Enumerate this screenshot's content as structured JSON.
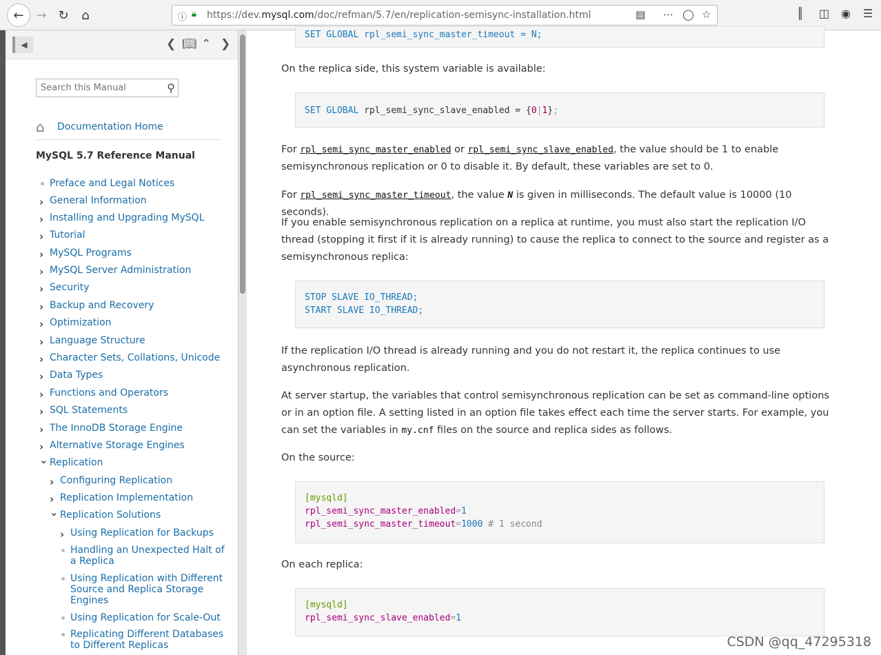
{
  "browser": {
    "url_prefix": "https://dev.",
    "url_domain": "mysql.com",
    "url_path": "/doc/refman/5.7/en/replication-semisync-installation.html"
  },
  "sidebar": {
    "search_placeholder": "Search this Manual",
    "doc_home": "Documentation Home",
    "manual_title": "MySQL 5.7 Reference Manual",
    "items": [
      {
        "label": "Preface and Legal Notices",
        "mark": "dot"
      },
      {
        "label": "General Information",
        "mark": "right"
      },
      {
        "label": "Installing and Upgrading MySQL",
        "mark": "right"
      },
      {
        "label": "Tutorial",
        "mark": "right"
      },
      {
        "label": "MySQL Programs",
        "mark": "right"
      },
      {
        "label": "MySQL Server Administration",
        "mark": "right"
      },
      {
        "label": "Security",
        "mark": "right"
      },
      {
        "label": "Backup and Recovery",
        "mark": "right"
      },
      {
        "label": "Optimization",
        "mark": "right"
      },
      {
        "label": "Language Structure",
        "mark": "right"
      },
      {
        "label": "Character Sets, Collations, Unicode",
        "mark": "right"
      },
      {
        "label": "Data Types",
        "mark": "right"
      },
      {
        "label": "Functions and Operators",
        "mark": "right"
      },
      {
        "label": "SQL Statements",
        "mark": "right"
      },
      {
        "label": "The InnoDB Storage Engine",
        "mark": "right"
      },
      {
        "label": "Alternative Storage Engines",
        "mark": "right"
      },
      {
        "label": "Replication",
        "mark": "down"
      },
      {
        "label": "Configuring Replication",
        "mark": "right"
      },
      {
        "label": "Replication Implementation",
        "mark": "right"
      },
      {
        "label": "Replication Solutions",
        "mark": "down"
      },
      {
        "label": "Using Replication for Backups",
        "mark": "right"
      },
      {
        "label": "Handling an Unexpected Halt of a Replica",
        "mark": "dot"
      },
      {
        "label": "Using Replication with Different Source and Replica Storage Engines",
        "mark": "dot"
      },
      {
        "label": "Using Replication for Scale-Out",
        "mark": "dot"
      },
      {
        "label": "Replicating Different Databases to Different Replicas",
        "mark": "dot"
      }
    ]
  },
  "content": {
    "code0_partial": "SET GLOBAL rpl_semi_sync_master_timeout = N;",
    "p1": "On the replica side, this system variable is available:",
    "code1": {
      "kw": "SET GLOBAL",
      "name": "rpl_semi_sync_slave_enabled",
      "eq": "=",
      "val": "{0|1}",
      "end": ";"
    },
    "p2": {
      "pre": "For ",
      "var1": "rpl_semi_sync_master_enabled",
      "mid": " or ",
      "var2": "rpl_semi_sync_slave_enabled",
      "post": ", the value should be 1 to enable semisynchronous replication or 0 to disable it. By default, these variables are set to 0."
    },
    "p3": {
      "pre": "For ",
      "var": "rpl_semi_sync_master_timeout",
      "mid": ", the value ",
      "n": "N",
      "post": " is given in milliseconds. The default value is 10000 (10 seconds)."
    },
    "p4": "If you enable semisynchronous replication on a replica at runtime, you must also start the replication I/O thread (stopping it first if it is already running) to cause the replica to connect to the source and register as a semisynchronous replica:",
    "code2": [
      "STOP SLAVE IO_THREAD;",
      "START SLAVE IO_THREAD;"
    ],
    "p5": "If the replication I/O thread is already running and you do not restart it, the replica continues to use asynchronous replication.",
    "p6": {
      "pre": "At server startup, the variables that control semisynchronous replication can be set as command-line options or in an option file. A setting listed in an option file takes effect each time the server starts. For example, you can set the variables in ",
      "file": "my.cnf",
      "post": " files on the source and replica sides as follows."
    },
    "p7": "On the source:",
    "code3": {
      "section": "[mysqld]",
      "l1_name": "rpl_semi_sync_master_enabled",
      "l1_val": "1",
      "l2_name": "rpl_semi_sync_master_timeout",
      "l2_val": "1000",
      "l2_comment": "# 1 second"
    },
    "p8": "On each replica:",
    "code4": {
      "section": "[mysqld]",
      "l1_name": "rpl_semi_sync_slave_enabled",
      "l1_val": "1"
    }
  },
  "watermark": "CSDN @qq_47295318"
}
